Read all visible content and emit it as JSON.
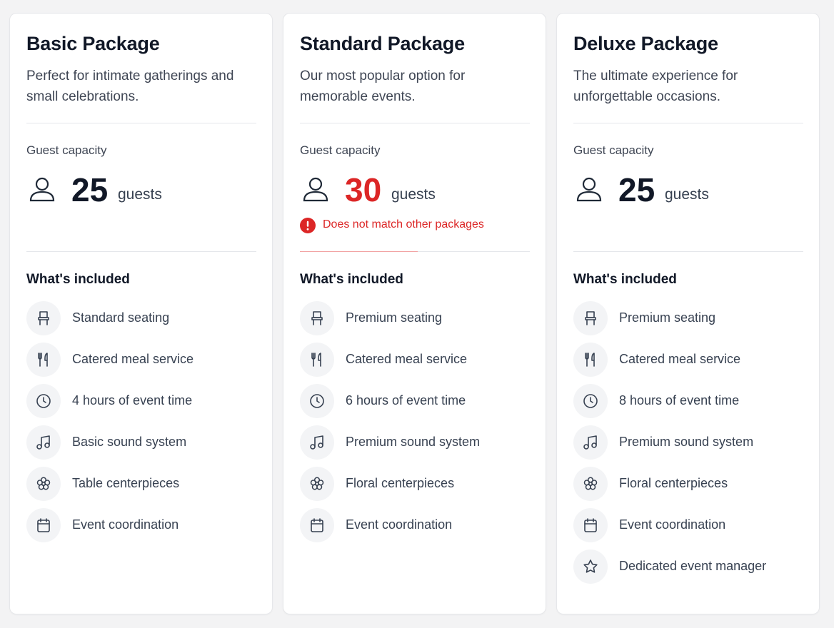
{
  "capacity_label": "Guest capacity",
  "capacity_unit": "guests",
  "included_heading": "What's included",
  "colors": {
    "error": "#dc2626",
    "text_dark": "#111827",
    "text_body": "#374151",
    "icon_bg": "#f3f4f6"
  },
  "packages": [
    {
      "title": "Basic Package",
      "description": "Perfect for intimate gatherings and small celebrations.",
      "guest_capacity": "25",
      "capacity_mismatch": false,
      "items": [
        {
          "icon": "chair-icon",
          "label": "Standard seating"
        },
        {
          "icon": "utensils-icon",
          "label": "Catered meal service"
        },
        {
          "icon": "clock-icon",
          "label": "4 hours of event time"
        },
        {
          "icon": "music-icon",
          "label": "Basic sound system"
        },
        {
          "icon": "flower-icon",
          "label": "Table centerpieces"
        },
        {
          "icon": "calendar-icon",
          "label": "Event coordination"
        }
      ]
    },
    {
      "title": "Standard Package",
      "description": "Our most popular option for memorable events.",
      "guest_capacity": "30",
      "capacity_mismatch": true,
      "warning": "Does not match other packages",
      "items": [
        {
          "icon": "chair-icon",
          "label": "Premium seating"
        },
        {
          "icon": "utensils-icon",
          "label": "Catered meal service"
        },
        {
          "icon": "clock-icon",
          "label": "6 hours of event time"
        },
        {
          "icon": "music-icon",
          "label": "Premium sound system"
        },
        {
          "icon": "flower-icon",
          "label": "Floral centerpieces"
        },
        {
          "icon": "calendar-icon",
          "label": "Event coordination"
        }
      ]
    },
    {
      "title": "Deluxe Package",
      "description": "The ultimate experience for unforgettable occasions.",
      "guest_capacity": "25",
      "capacity_mismatch": false,
      "items": [
        {
          "icon": "chair-icon",
          "label": "Premium seating"
        },
        {
          "icon": "utensils-icon",
          "label": "Catered meal service"
        },
        {
          "icon": "clock-icon",
          "label": "8 hours of event time"
        },
        {
          "icon": "music-icon",
          "label": "Premium sound system"
        },
        {
          "icon": "flower-icon",
          "label": "Floral centerpieces"
        },
        {
          "icon": "calendar-icon",
          "label": "Event coordination"
        },
        {
          "icon": "star-icon",
          "label": "Dedicated event manager"
        }
      ]
    }
  ]
}
